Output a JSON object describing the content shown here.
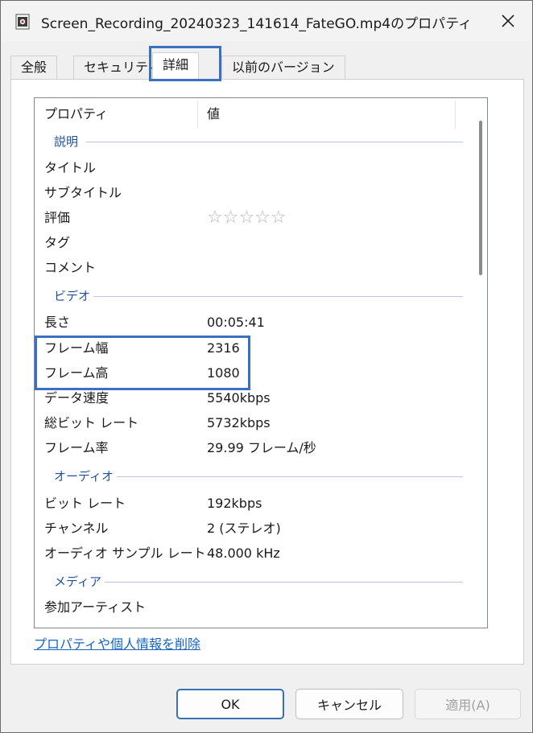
{
  "window": {
    "title": "Screen_Recording_20240323_141614_FateGO.mp4のプロパティ"
  },
  "tabs": [
    {
      "label": "全般"
    },
    {
      "label": "セキュリティ"
    },
    {
      "label": "詳細"
    },
    {
      "label": "以前のバージョン"
    }
  ],
  "list": {
    "header": {
      "property": "プロパティ",
      "value": "値"
    },
    "groups": {
      "description": "説明",
      "video": "ビデオ",
      "audio": "オーディオ",
      "media": "メディア"
    },
    "rows": [
      {
        "name": "タイトル",
        "value": ""
      },
      {
        "name": "サブタイトル",
        "value": ""
      },
      {
        "name": "評価",
        "value": "☆☆☆☆☆"
      },
      {
        "name": "タグ",
        "value": ""
      },
      {
        "name": "コメント",
        "value": ""
      },
      {
        "name": "長さ",
        "value": "00:05:41"
      },
      {
        "name": "フレーム幅",
        "value": "2316"
      },
      {
        "name": "フレーム高",
        "value": "1080"
      },
      {
        "name": "データ速度",
        "value": "5540kbps"
      },
      {
        "name": "総ビット レート",
        "value": "5732kbps"
      },
      {
        "name": "フレーム率",
        "value": "29.99 フレーム/秒"
      },
      {
        "name": "ビット レート",
        "value": "192kbps"
      },
      {
        "name": "チャンネル",
        "value": "2 (ステレオ)"
      },
      {
        "name": "オーディオ サンプル レート",
        "value": "48.000 kHz"
      },
      {
        "name": "参加アーティスト",
        "value": ""
      }
    ]
  },
  "link_text": "プロパティや個人情報を削除",
  "buttons": {
    "ok": "OK",
    "cancel": "キャンセル",
    "apply": "適用(A)"
  },
  "colors": {
    "highlight": "#3a6fc1",
    "group": "#1f4e9b",
    "link": "#1565c0"
  }
}
